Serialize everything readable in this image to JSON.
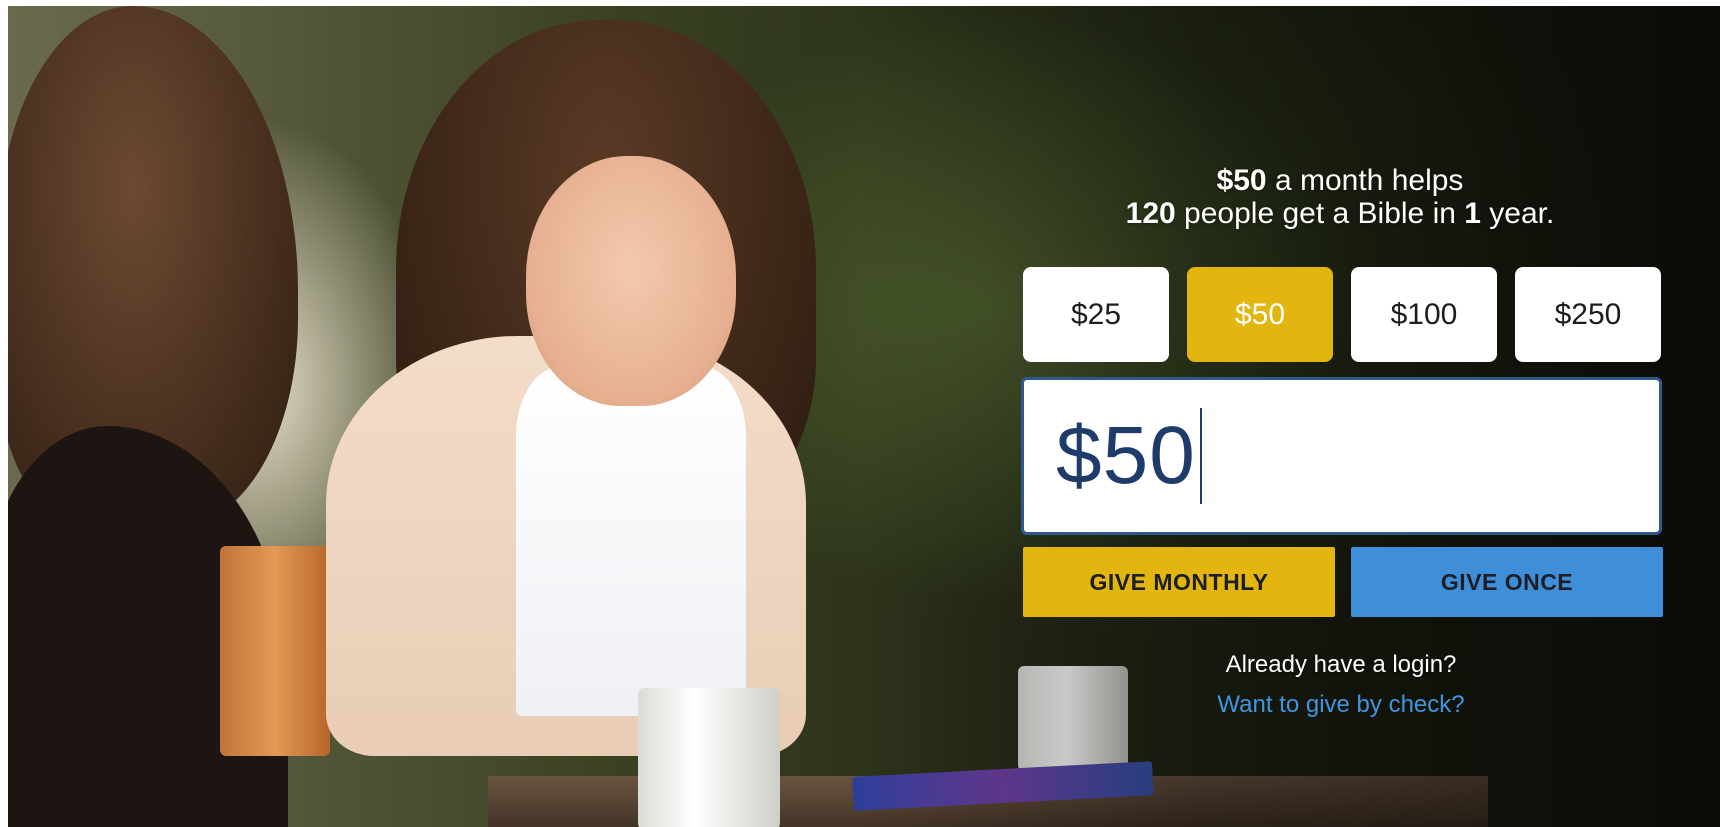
{
  "headline": {
    "amount": "$50",
    "line1_rest": " a month helps",
    "people_count": "120",
    "line2_middle": " people get a Bible in ",
    "years": "1",
    "line2_end": " year."
  },
  "amount_options": [
    {
      "label": "$25",
      "selected": false
    },
    {
      "label": "$50",
      "selected": true
    },
    {
      "label": "$100",
      "selected": false
    },
    {
      "label": "$250",
      "selected": false
    }
  ],
  "amount_input": {
    "value": "$50"
  },
  "actions": {
    "give_monthly_label": "GIVE MONTHLY",
    "give_once_label": "GIVE ONCE"
  },
  "links": {
    "login_label": "Already have a login?",
    "check_label": "Want to give by check?"
  },
  "colors": {
    "accent_gold": "#e3b50f",
    "accent_blue": "#3f8fd8",
    "link_blue": "#3f95e0",
    "input_text": "#1f3b6a"
  }
}
